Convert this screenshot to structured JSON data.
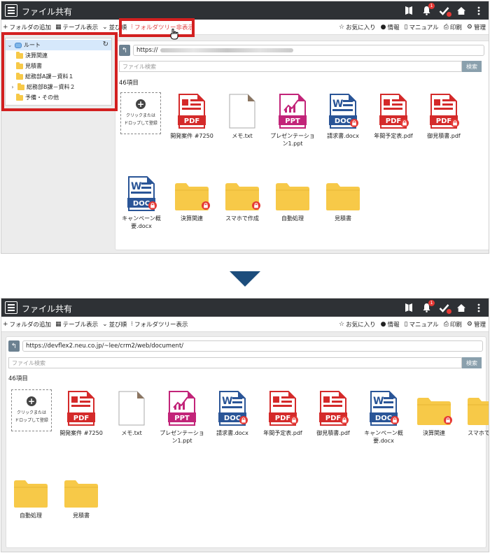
{
  "app_title": "ファイル共有",
  "header_icons": [
    "bookmark-icon",
    "bell-icon",
    "check-icon",
    "home-icon",
    "more-vertical-icon"
  ],
  "bell_badge": "1",
  "toolbar": {
    "add_folder": "フォルダの追加",
    "table_view": "テーブル表示",
    "sort": "並び順",
    "tree_hide": "フォルダツリー非表示",
    "tree_show": "フォルダツリー表示",
    "favorites": "お気に入り",
    "info": "情報",
    "manual": "マニュアル",
    "print": "印刷",
    "admin": "管理"
  },
  "tree": {
    "root": "ルート",
    "items": [
      "決算関連",
      "見積書",
      "総務部A課－資料１",
      "総務部B課－資料２",
      "予備・その他"
    ]
  },
  "path": {
    "url_prefix_blurred": "https://",
    "url_full": "https://devflex2.neu.co.jp/~lee/crm2/web/document/"
  },
  "search": {
    "placeholder": "ファイル検索",
    "button": "検索"
  },
  "item_count": "46項目",
  "upload": {
    "line1": "クリックまたは",
    "line2": "ドロップして登録"
  },
  "files": [
    {
      "name": "開発案件 #7250",
      "type": "pdf",
      "icon_text": "PDF",
      "locked": false
    },
    {
      "name": "メモ.txt",
      "type": "txt",
      "locked": false
    },
    {
      "name": "プレゼンテーション1.ppt",
      "type": "ppt",
      "icon_text": "PPT",
      "locked": false
    },
    {
      "name": "請求書.docx",
      "type": "doc",
      "icon_text": "DOC",
      "locked": true
    },
    {
      "name": "年間予定表.pdf",
      "type": "pdf",
      "icon_text": "PDF",
      "locked": true
    },
    {
      "name": "御見積書.pdf",
      "type": "pdf",
      "icon_text": "PDF",
      "locked": true
    },
    {
      "name": "キャンペーン概要.docx",
      "type": "doc",
      "icon_text": "DOC",
      "locked": true
    },
    {
      "name": "決算関連",
      "type": "folder",
      "locked": true
    },
    {
      "name": "スマホで作成",
      "type": "folder",
      "locked": true
    },
    {
      "name": "自動処理",
      "type": "folder",
      "locked": false
    },
    {
      "name": "見積書",
      "type": "folder",
      "locked": false
    }
  ],
  "colors": {
    "header_bg": "#2e3135",
    "highlight": "#d32020",
    "pdf": "#d42a2a",
    "doc": "#2a5597",
    "ppt": "#c22479",
    "folder": "#f7c948",
    "arrow": "#1c4d7c"
  }
}
